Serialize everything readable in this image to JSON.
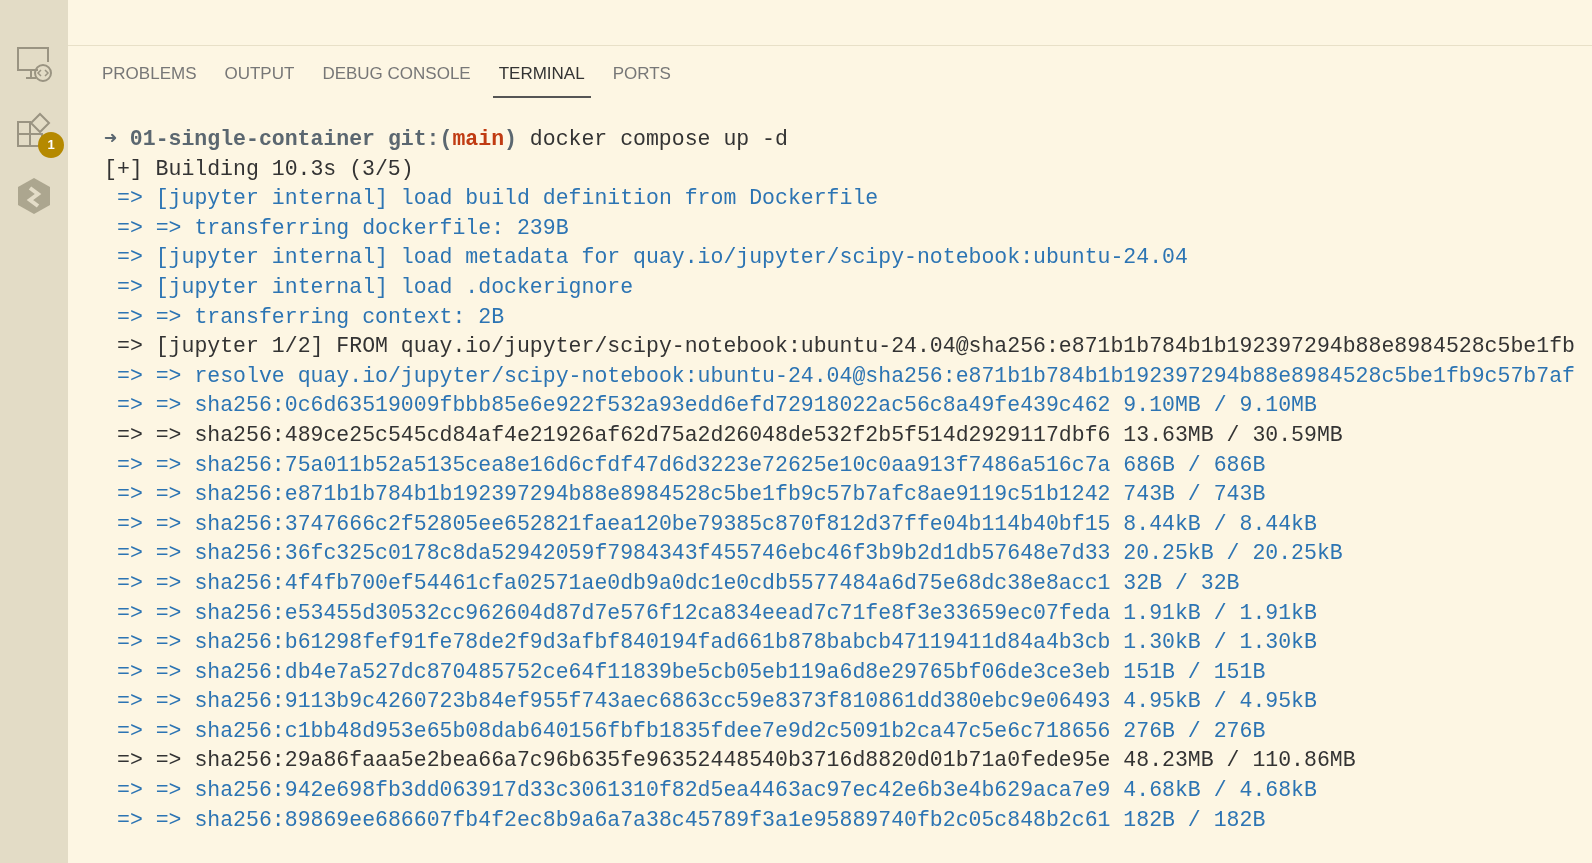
{
  "activity_bar": {
    "items": [
      {
        "kind": "remote"
      },
      {
        "kind": "extensions",
        "badge": "1"
      },
      {
        "kind": "hexagon"
      }
    ]
  },
  "panel": {
    "tabs": [
      {
        "label": "PROBLEMS",
        "selected": false
      },
      {
        "label": "OUTPUT",
        "selected": false
      },
      {
        "label": "DEBUG CONSOLE",
        "selected": false
      },
      {
        "label": "TERMINAL",
        "selected": true
      },
      {
        "label": "PORTS",
        "selected": false
      }
    ]
  },
  "terminal": {
    "prompt": {
      "arrow": "➜",
      "directory": "01-single-container",
      "git_open": "git:(",
      "branch": "main",
      "git_close": ")",
      "command": "docker compose up -d"
    },
    "lines": [
      {
        "text": "[+] Building 10.3s (3/5)",
        "color": "#333333",
        "indent": false
      },
      {
        "text": "=> [jupyter internal] load build definition from Dockerfile",
        "color": "#2c74b3",
        "indent": true
      },
      {
        "text": "=> => transferring dockerfile: 239B",
        "color": "#2c74b3",
        "indent": true
      },
      {
        "text": "=> [jupyter internal] load metadata for quay.io/jupyter/scipy-notebook:ubuntu-24.04",
        "color": "#2c74b3",
        "indent": true
      },
      {
        "text": "=> [jupyter internal] load .dockerignore",
        "color": "#2c74b3",
        "indent": true
      },
      {
        "text": "=> => transferring context: 2B",
        "color": "#2c74b3",
        "indent": true
      },
      {
        "text": "=> [jupyter 1/2] FROM quay.io/jupyter/scipy-notebook:ubuntu-24.04@sha256:e871b1b784b1b192397294b88e8984528c5be1fb",
        "color": "#333333",
        "indent": true
      },
      {
        "text": "=> => resolve quay.io/jupyter/scipy-notebook:ubuntu-24.04@sha256:e871b1b784b1b192397294b88e8984528c5be1fb9c57b7af",
        "color": "#2c74b3",
        "indent": true
      },
      {
        "text": "=> => sha256:0c6d63519009fbbb85e6e922f532a93edd6efd72918022ac56c8a49fe439c462 9.10MB / 9.10MB",
        "color": "#2c74b3",
        "indent": true
      },
      {
        "text": "=> => sha256:489ce25c545cd84af4e21926af62d75a2d26048de532f2b5f514d2929117dbf6 13.63MB / 30.59MB",
        "color": "#333333",
        "indent": true
      },
      {
        "text": "=> => sha256:75a011b52a5135cea8e16d6cfdf47d6d3223e72625e10c0aa913f7486a516c7a 686B / 686B",
        "color": "#2c74b3",
        "indent": true
      },
      {
        "text": "=> => sha256:e871b1b784b1b192397294b88e8984528c5be1fb9c57b7afc8ae9119c51b1242 743B / 743B",
        "color": "#2c74b3",
        "indent": true
      },
      {
        "text": "=> => sha256:3747666c2f52805ee652821faea120be79385c870f812d37ffe04b114b40bf15 8.44kB / 8.44kB",
        "color": "#2c74b3",
        "indent": true
      },
      {
        "text": "=> => sha256:36fc325c0178c8da52942059f7984343f455746ebc46f3b9b2d1db57648e7d33 20.25kB / 20.25kB",
        "color": "#2c74b3",
        "indent": true
      },
      {
        "text": "=> => sha256:4f4fb700ef54461cfa02571ae0db9a0dc1e0cdb5577484a6d75e68dc38e8acc1 32B / 32B",
        "color": "#2c74b3",
        "indent": true
      },
      {
        "text": "=> => sha256:e53455d30532cc962604d87d7e576f12ca834eead7c71fe8f3e33659ec07feda 1.91kB / 1.91kB",
        "color": "#2c74b3",
        "indent": true
      },
      {
        "text": "=> => sha256:b61298fef91fe78de2f9d3afbf840194fad661b878babcb47119411d84a4b3cb 1.30kB / 1.30kB",
        "color": "#2c74b3",
        "indent": true
      },
      {
        "text": "=> => sha256:db4e7a527dc870485752ce64f11839be5cb05eb119a6d8e29765bf06de3ce3eb 151B / 151B",
        "color": "#2c74b3",
        "indent": true
      },
      {
        "text": "=> => sha256:9113b9c4260723b84ef955f743aec6863cc59e8373f810861dd380ebc9e06493 4.95kB / 4.95kB",
        "color": "#2c74b3",
        "indent": true
      },
      {
        "text": "=> => sha256:c1bb48d953e65b08dab640156fbfb1835fdee7e9d2c5091b2ca47c5e6c718656 276B / 276B",
        "color": "#2c74b3",
        "indent": true
      },
      {
        "text": "=> => sha256:29a86faaa5e2bea66a7c96b635fe96352448540b3716d8820d01b71a0fede95e 48.23MB / 110.86MB",
        "color": "#333333",
        "indent": true
      },
      {
        "text": "=> => sha256:942e698fb3dd063917d33c3061310f82d5ea4463ac97ec42e6b3e4b629aca7e9 4.68kB / 4.68kB",
        "color": "#2c74b3",
        "indent": true
      },
      {
        "text": "=> => sha256:89869ee686607fb4f2ec8b9a6a7a38c45789f3a1e95889740fb2c05c848b2c61 182B / 182B",
        "color": "#2c74b3",
        "indent": true
      }
    ]
  }
}
